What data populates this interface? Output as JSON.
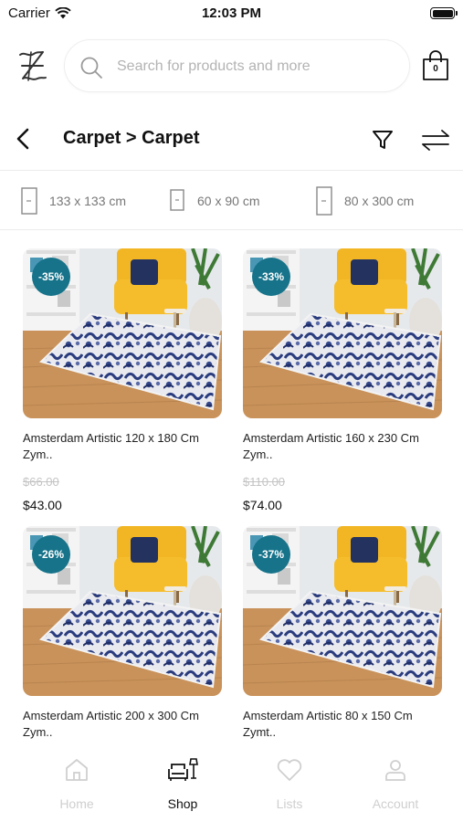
{
  "status_bar": {
    "carrier": "Carrier",
    "time": "12:03 PM"
  },
  "header": {
    "search_placeholder": "Search for products and more",
    "cart_count": "0",
    "logo": "brand-logo"
  },
  "title": {
    "breadcrumb": "Carpet > Carpet"
  },
  "sizes": [
    {
      "label": "133 x 133 cm"
    },
    {
      "label": "60 x 90 cm"
    },
    {
      "label": "80 x 300 cm"
    }
  ],
  "products": [
    {
      "name": "Amsterdam Artistic 120 x 180 Cm Zym..",
      "discount": "-35%",
      "old_price": "$66.00",
      "price": "$43.00"
    },
    {
      "name": "Amsterdam Artistic 160 x 230 Cm Zym..",
      "discount": "-33%",
      "old_price": "$110.00",
      "price": "$74.00"
    },
    {
      "name": "Amsterdam Artistic 200 x 300 Cm Zym..",
      "discount": "-26%"
    },
    {
      "name": "Amsterdam Artistic 80 x 150 Cm Zymt..",
      "discount": "-37%"
    }
  ],
  "tabs": [
    {
      "label": "Home",
      "icon": "home-icon",
      "active": false
    },
    {
      "label": "Shop",
      "icon": "furniture-icon",
      "active": true
    },
    {
      "label": "Lists",
      "icon": "heart-icon",
      "active": false
    },
    {
      "label": "Account",
      "icon": "user-icon",
      "active": false
    }
  ],
  "colors": {
    "badge": "#16738a",
    "inactive_tab": "#cfcfcf",
    "strike_price": "#c4c4c4"
  }
}
